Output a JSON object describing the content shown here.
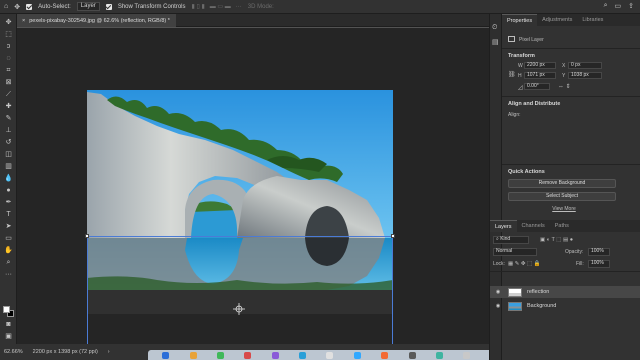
{
  "options_bar": {
    "auto_select_label": "Auto-Select:",
    "auto_select_value": "Layer",
    "show_transform_label": "Show Transform Controls",
    "mode_3d_label": "3D Mode:"
  },
  "document": {
    "tab_title": "pexels-pixabay-302549.jpg @ 62.6% (reflection, RGB/8) *",
    "close_glyph": "×"
  },
  "status": {
    "zoom": "62.66%",
    "dimensions": "2200 px x 1398 px (72 ppi)",
    "arrow": "›"
  },
  "properties_panel": {
    "tabs": [
      "Properties",
      "Adjustments",
      "Libraries"
    ],
    "layer_type": "Pixel Layer",
    "transform_title": "Transform",
    "w_label": "W",
    "w_value": "2200 px",
    "x_label": "X",
    "x_value": "0 px",
    "h_label": "H",
    "h_value": "1071 px",
    "y_label": "Y",
    "y_value": "1038 px",
    "angle_value": "0.00°",
    "align_title": "Align and Distribute",
    "align_label": "Align:",
    "quick_actions_title": "Quick Actions",
    "remove_bg_button": "Remove Background",
    "select_subject_button": "Select Subject",
    "view_more_link": "View More"
  },
  "layers_panel": {
    "tabs": [
      "Layers",
      "Channels",
      "Paths"
    ],
    "filter_label": "Kind",
    "blend_mode": "Normal",
    "opacity_label": "Opacity:",
    "opacity_value": "100%",
    "lock_label": "Lock:",
    "fill_label": "Fill:",
    "fill_value": "100%",
    "layers": [
      {
        "name": "reflection"
      },
      {
        "name": "Background"
      }
    ]
  },
  "colors": {
    "accent": "#4b7bd5",
    "sky": "#3a9fe0",
    "water": "#1d8fc7"
  },
  "icons": {
    "move_tool": "move-icon",
    "home": "home-icon",
    "search": "search-icon",
    "share": "share-icon",
    "eye": "eye-icon"
  }
}
